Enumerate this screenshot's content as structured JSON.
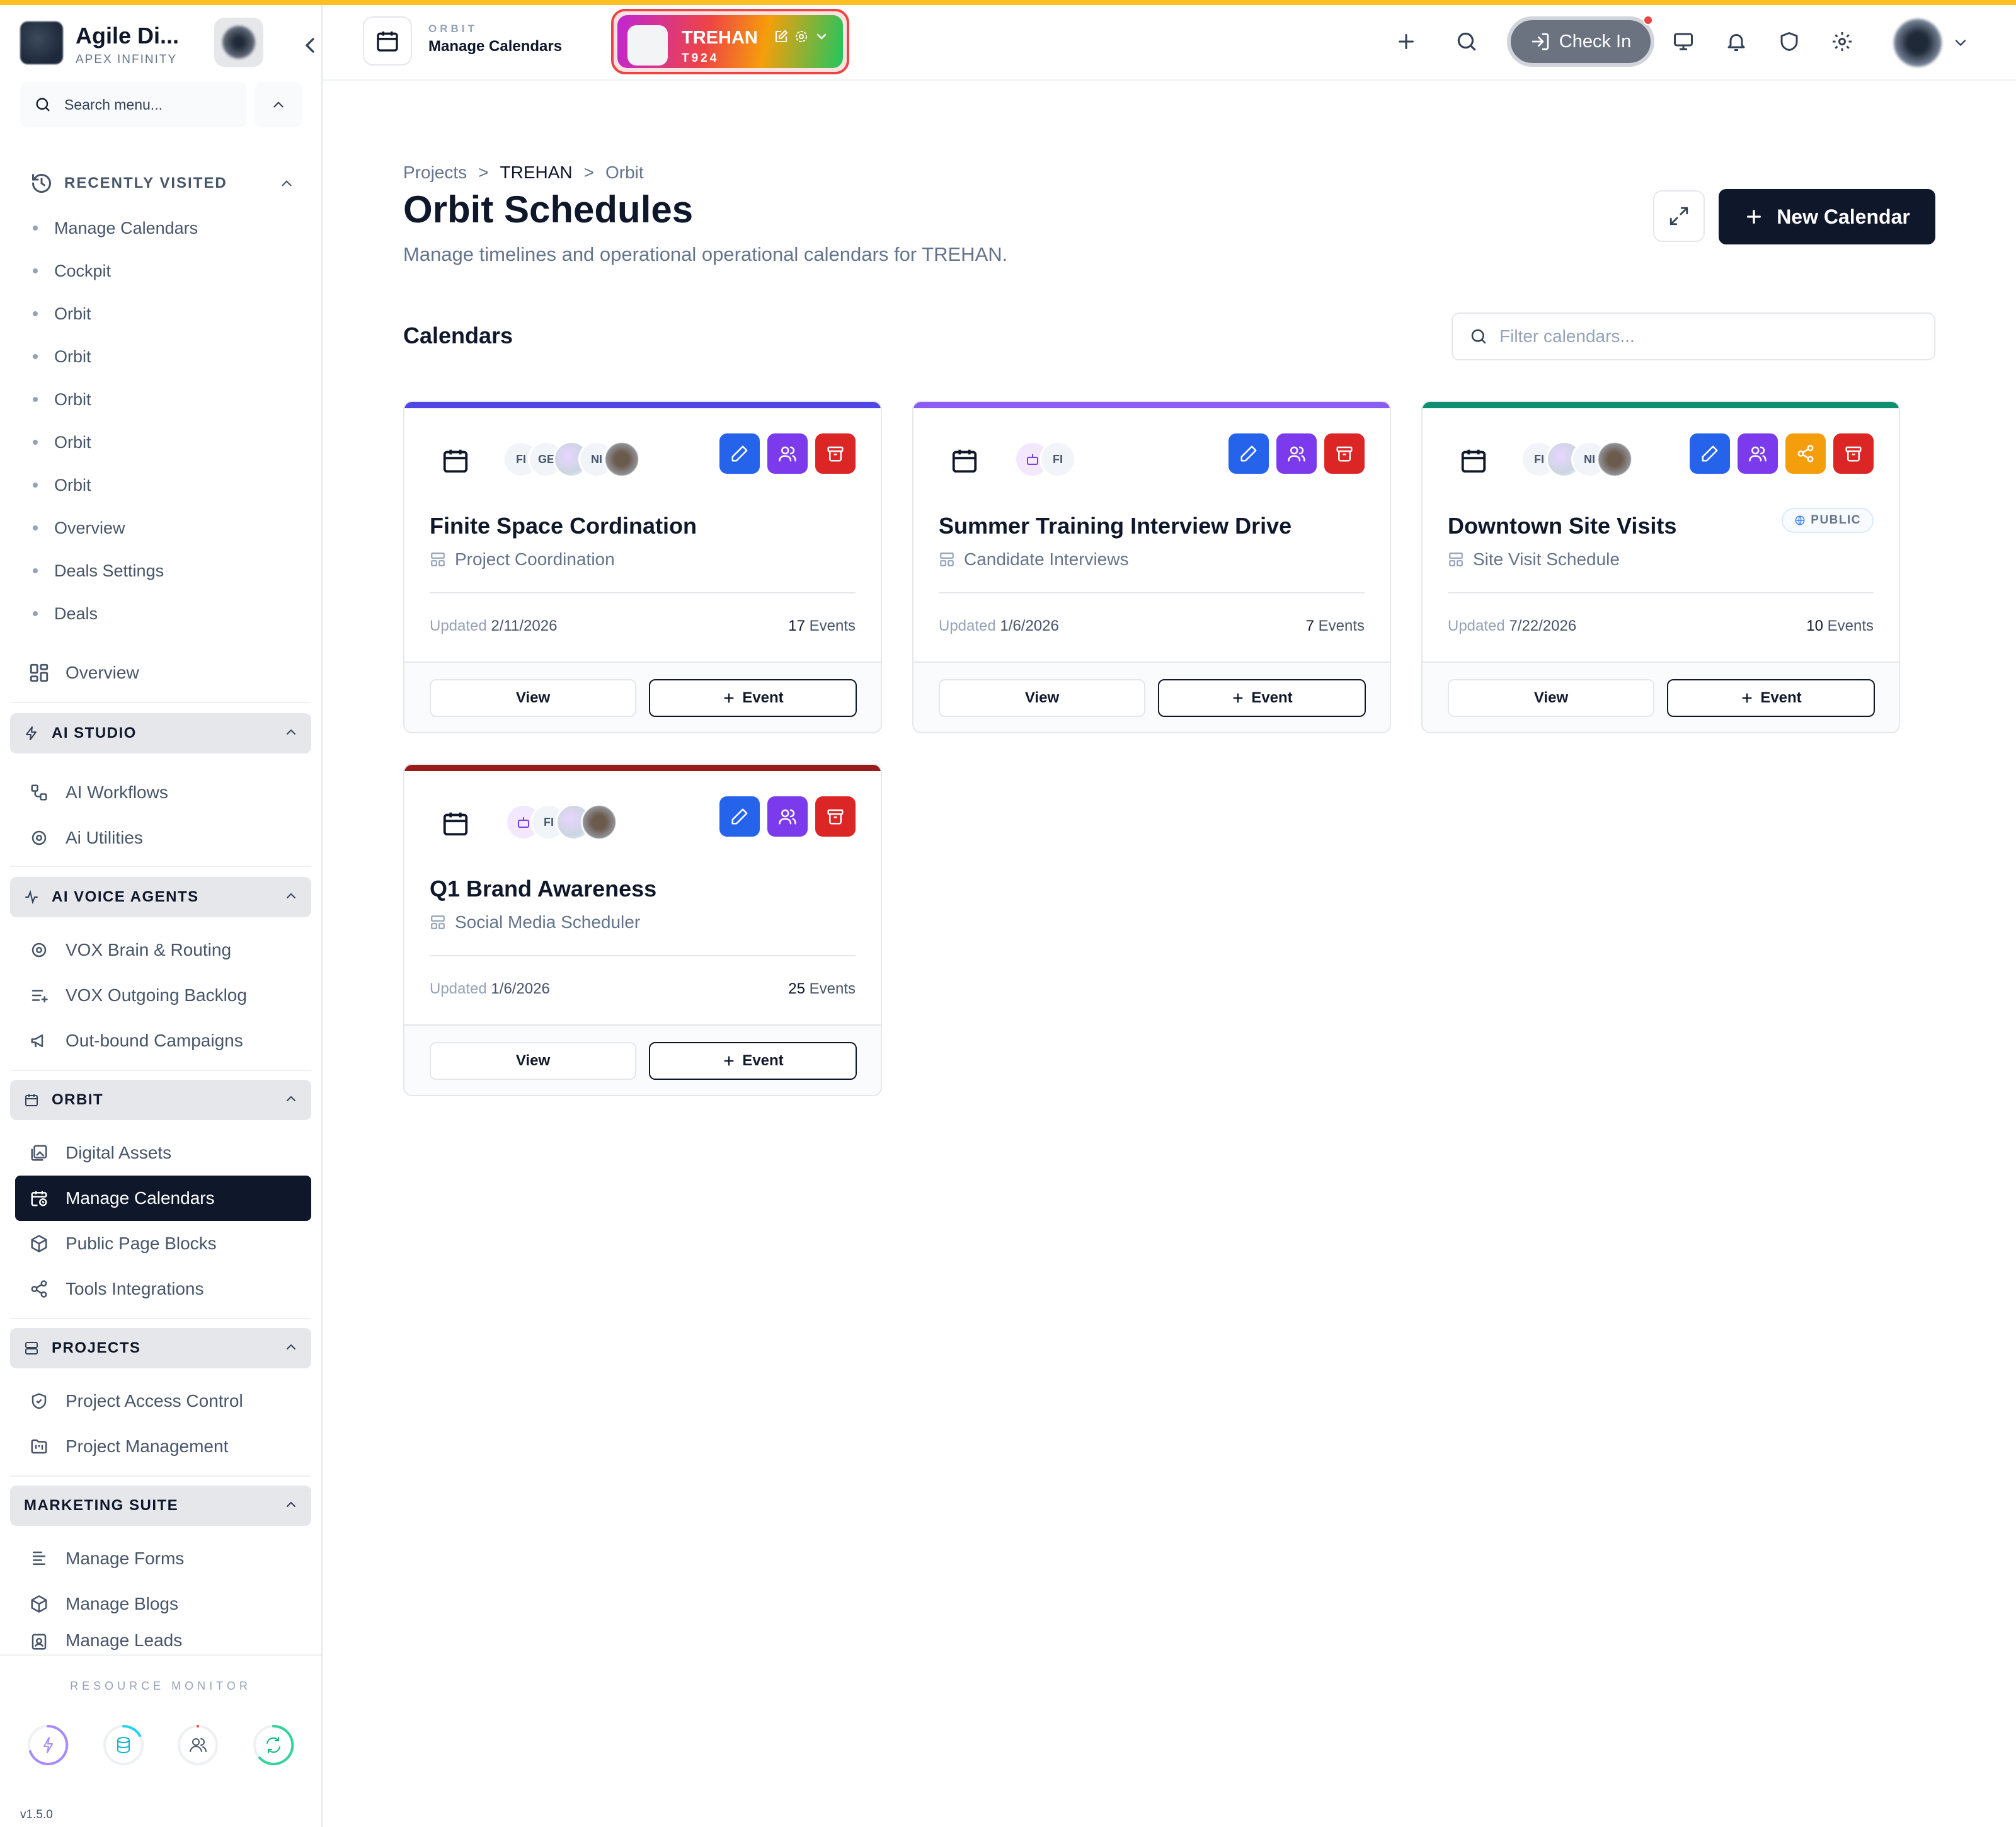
{
  "sidebar": {
    "brand_name": "Agile Di...",
    "brand_sub": "APEX INFINITY",
    "search_placeholder": "Search menu...",
    "recently_visited_label": "RECENTLY VISITED",
    "recently_visited": [
      "Manage Calendars",
      "Cockpit",
      "Orbit",
      "Orbit",
      "Orbit",
      "Orbit",
      "Orbit",
      "Overview",
      "Deals Settings",
      "Deals"
    ],
    "overview": "Overview",
    "ai_studio": {
      "title": "AI STUDIO",
      "items": [
        "AI Workflows",
        "Ai Utilities"
      ]
    },
    "ai_voice": {
      "title": "AI VOICE AGENTS",
      "items": [
        "VOX Brain & Routing",
        "VOX Outgoing Backlog",
        "Out-bound Campaigns"
      ]
    },
    "orbit": {
      "title": "ORBIT",
      "items": [
        "Digital Assets",
        "Manage Calendars",
        "Public Page Blocks",
        "Tools Integrations"
      ]
    },
    "projects": {
      "title": "PROJECTS",
      "items": [
        "Project Access Control",
        "Project Management"
      ]
    },
    "marketing": {
      "title": "MARKETING SUITE",
      "items": [
        "Manage Forms",
        "Manage Blogs",
        "Manage Leads"
      ]
    },
    "resource_monitor": "RESOURCE MONITOR",
    "version": "v1.5.0"
  },
  "header": {
    "module_label": "ORBIT",
    "page_label": "Manage Calendars",
    "project_name": "TREHAN",
    "project_code": "T924",
    "checkin_label": "Check In"
  },
  "main": {
    "breadcrumb": [
      "Projects",
      ">",
      "TREHAN",
      ">",
      "Orbit"
    ],
    "title": "Orbit Schedules",
    "subtitle": "Manage timelines and operational operational calendars for TREHAN.",
    "new_button": "New Calendar",
    "section_title": "Calendars",
    "filter_placeholder": "Filter calendars...",
    "cards": [
      {
        "title": "Finite Space Cordination",
        "subtitle": "Project Coordination",
        "updated_label": "Updated",
        "updated": "2/11/2026",
        "events_count": "17",
        "events_label": "Events",
        "view": "View",
        "event_btn": "Event",
        "avatars": [
          "FI",
          "GE",
          "",
          "NI",
          ""
        ]
      },
      {
        "title": "Summer Training Interview Drive",
        "subtitle": "Candidate Interviews",
        "updated_label": "Updated",
        "updated": "1/6/2026",
        "events_count": "7",
        "events_label": "Events",
        "view": "View",
        "event_btn": "Event",
        "avatars": [
          "",
          "FI"
        ]
      },
      {
        "title": "Downtown Site Visits",
        "subtitle": "Site Visit Schedule",
        "badge": "PUBLIC",
        "updated_label": "Updated",
        "updated": "7/22/2026",
        "events_count": "10",
        "events_label": "Events",
        "view": "View",
        "event_btn": "Event",
        "avatars": [
          "FI",
          "",
          "NI",
          ""
        ]
      },
      {
        "title": "Q1 Brand Awareness",
        "subtitle": "Social Media Scheduler",
        "updated_label": "Updated",
        "updated": "1/6/2026",
        "events_count": "25",
        "events_label": "Events",
        "view": "View",
        "event_btn": "Event",
        "avatars": [
          "",
          "FI",
          "",
          ""
        ]
      }
    ]
  },
  "colors": {
    "card_bars": [
      "#4f46e5",
      "#8b5cf6",
      "#0f8f6f",
      "#991b1b"
    ],
    "accent_dark": "#0f172a",
    "edit": "#2563eb",
    "members": "#7c3aed",
    "archive": "#dc2626",
    "share": "#f59e0b"
  }
}
